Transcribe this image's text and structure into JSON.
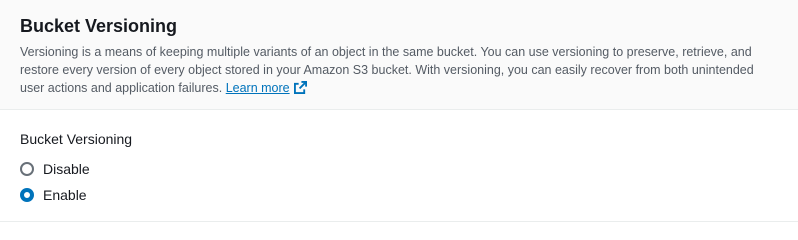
{
  "section": {
    "title": "Bucket Versioning",
    "description": "Versioning is a means of keeping multiple variants of an object in the same bucket. You can use versioning to preserve, retrieve, and restore every version of every object stored in your Amazon S3 bucket. With versioning, you can easily recover from both unintended user actions and application failures.",
    "learn_more": "Learn more",
    "learn_more_icon": "external-link-icon"
  },
  "field": {
    "label": "Bucket Versioning",
    "options": [
      {
        "label": "Disable",
        "checked": false
      },
      {
        "label": "Enable",
        "checked": true
      }
    ]
  },
  "colors": {
    "accent": "#0073bb",
    "header_bg": "#fafafa",
    "text": "#16191f",
    "muted_text": "#545b64"
  }
}
